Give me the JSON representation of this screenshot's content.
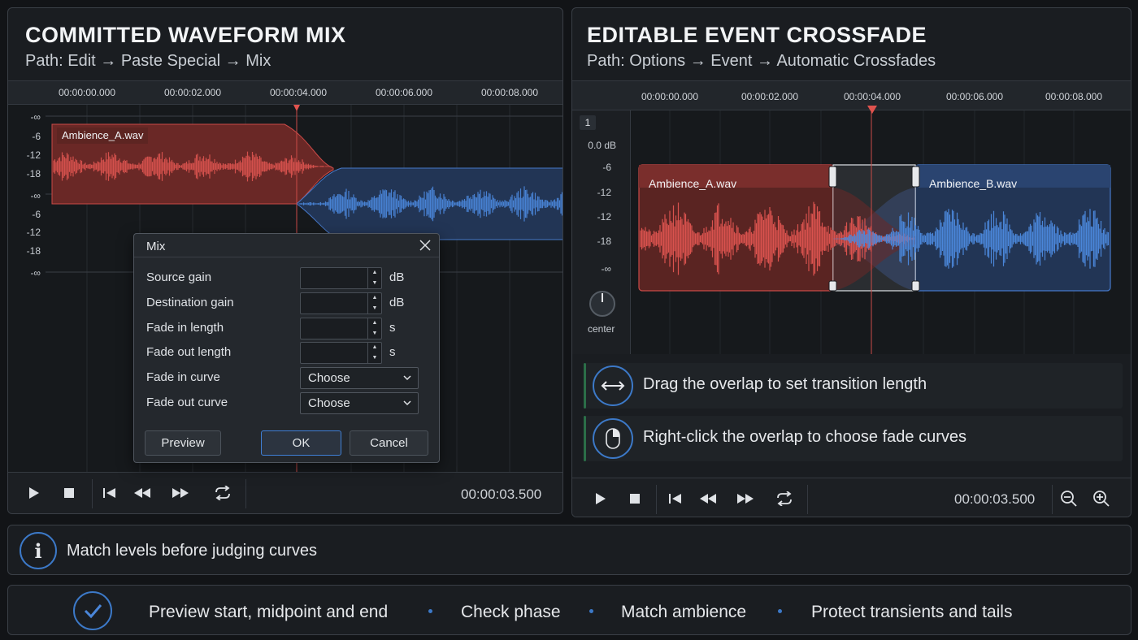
{
  "left_panel": {
    "title": "COMMITTED WAVEFORM MIX",
    "path": "Path: Edit → Paste Special → Mix",
    "ruler": [
      "00:00:00.000",
      "00:00:02.000",
      "00:00:04.000",
      "00:00:06.000",
      "00:00:08.000"
    ],
    "db_labels": [
      "-∞",
      "-6",
      "-12",
      "-18",
      "-∞",
      "-6",
      "-12",
      "-18",
      "-∞"
    ],
    "clip_name": "Ambience_A.wav",
    "timecode": "00:00:03.500"
  },
  "mix_dialog": {
    "title": "Mix",
    "rows": [
      {
        "label": "Source gain",
        "unit": "dB"
      },
      {
        "label": "Destination gain",
        "unit": "dB"
      },
      {
        "label": "Fade in length",
        "unit": "s"
      },
      {
        "label": "Fade out length",
        "unit": "s"
      }
    ],
    "fade_in_curve_label": "Fade in curve",
    "fade_out_curve_label": "Fade out curve",
    "fade_in_curve_value": "Choose",
    "fade_out_curve_value": "Choose",
    "preview": "Preview",
    "ok": "OK",
    "cancel": "Cancel"
  },
  "right_panel": {
    "title": "EDITABLE EVENT CROSSFADE",
    "path": "Path: Options → Event → Automatic Crossfades",
    "ruler": [
      "00:00:00.000",
      "00:00:02.000",
      "00:00:04.000",
      "00:00:06.000",
      "00:00:08.000"
    ],
    "track_number": "1",
    "gain": "0.0 dB",
    "db_labels": [
      "-6",
      "-12",
      "-12",
      "-18",
      "-∞"
    ],
    "pan": "center",
    "clip_a": "Ambience_A.wav",
    "clip_b": "Ambience_B.wav",
    "tips": [
      "Drag the overlap to set transition length",
      "Right-click the overlap to choose fade curves"
    ],
    "timecode": "00:00:03.500"
  },
  "info_bar": {
    "text": "Match levels before judging curves"
  },
  "checklist": {
    "items": [
      "Preview start, midpoint and end",
      "Check phase",
      "Match ambience",
      "Protect transients and tails"
    ]
  },
  "colors": {
    "red": "#c94a47",
    "blue": "#4679c9",
    "accent": "#3c79c8"
  }
}
